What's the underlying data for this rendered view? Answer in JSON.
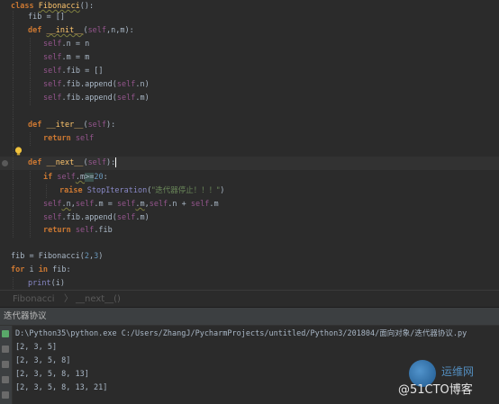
{
  "editor": {
    "lines": [
      [
        "class ",
        "Fibonacci",
        "():"
      ],
      [
        "fib = []"
      ],
      [
        "def ",
        "__init__",
        "(",
        "self",
        ",n,m):"
      ],
      [
        "self",
        ".n = n"
      ],
      [
        "self",
        ".m = m"
      ],
      [
        "self",
        ".fib = []"
      ],
      [
        "self",
        ".fib.append(",
        "self",
        ".n)"
      ],
      [
        "self",
        ".fib.append(",
        "self",
        ".m)"
      ],
      [],
      [
        "def ",
        "__iter__",
        "(",
        "self",
        "):"
      ],
      [
        "return ",
        "self"
      ],
      [],
      [
        "def ",
        "__next__",
        "(",
        "self",
        "):"
      ],
      [
        "if ",
        "self",
        ".m",
        ">=",
        "20",
        ":"
      ],
      [
        "raise ",
        "StopIteration",
        "(",
        "\"迭代器停止！！！\"",
        ")"
      ],
      [
        "self",
        ".n",
        ",",
        "self",
        ".m = ",
        "self",
        ".m",
        ",",
        "self",
        ".n + ",
        "self",
        ".m"
      ],
      [
        "self",
        ".fib.append(",
        "self",
        ".m)"
      ],
      [
        "return ",
        "self",
        ".fib"
      ],
      [],
      [
        "fib = Fibonacci(",
        "2",
        ",",
        "3",
        ")"
      ],
      [
        "for ",
        "i ",
        "in ",
        "fib:"
      ],
      [
        "print",
        "(i)"
      ]
    ]
  },
  "breadcrumb": {
    "class_name": "Fibonacci",
    "separator": "〉",
    "method_name": "__next__()"
  },
  "run_panel": {
    "title": "迭代器协议"
  },
  "console": {
    "command": "D:\\Python35\\python.exe C:/Users/ZhangJ/PycharmProjects/untitled/Python3/201804/面向对象/迭代器协议.py",
    "output": [
      "[2, 3, 5]",
      "[2, 3, 5, 8]",
      "[2, 3, 5, 8, 13]",
      "[2, 3, 5, 8, 13, 21]"
    ]
  },
  "watermark": {
    "site": "运维网",
    "brand": "@51CTO博客"
  },
  "colors": {
    "background": "#2b2b2b",
    "keyword": "#cc7832",
    "self": "#94558d",
    "function": "#ffc66d",
    "number": "#6897bb",
    "string": "#6a8759"
  }
}
